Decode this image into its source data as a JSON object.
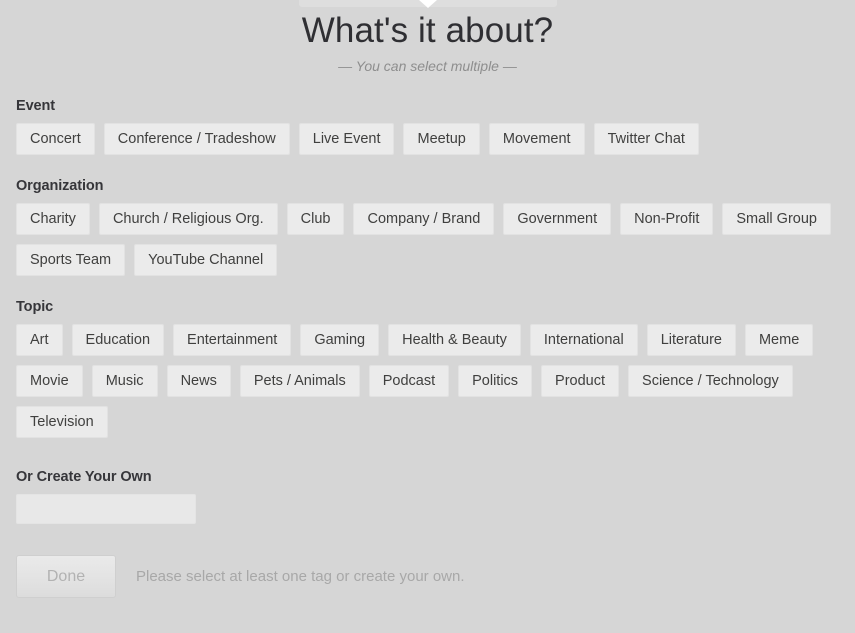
{
  "header": {
    "title": "What's it about?",
    "subtitle": "— You can select multiple —"
  },
  "sections": [
    {
      "heading": "Event",
      "tags": [
        "Concert",
        "Conference / Tradeshow",
        "Live Event",
        "Meetup",
        "Movement",
        "Twitter Chat"
      ]
    },
    {
      "heading": "Organization",
      "tags": [
        "Charity",
        "Church / Religious Org.",
        "Club",
        "Company / Brand",
        "Government",
        "Non-Profit",
        "Small Group",
        "Sports Team",
        "YouTube Channel"
      ]
    },
    {
      "heading": "Topic",
      "tags": [
        "Art",
        "Education",
        "Entertainment",
        "Gaming",
        "Health & Beauty",
        "International",
        "Literature",
        "Meme",
        "Movie",
        "Music",
        "News",
        "Pets / Animals",
        "Podcast",
        "Politics",
        "Product",
        "Science / Technology",
        "Television"
      ]
    }
  ],
  "create": {
    "heading": "Or Create Your Own",
    "value": "",
    "placeholder": ""
  },
  "footer": {
    "done_label": "Done",
    "hint": "Please select at least one tag or create your own."
  },
  "colors": {
    "background": "#d6d6d6",
    "tag_fill": "#ebebeb",
    "heading_text": "#36363a",
    "hint_text": "#a8a8a8"
  }
}
